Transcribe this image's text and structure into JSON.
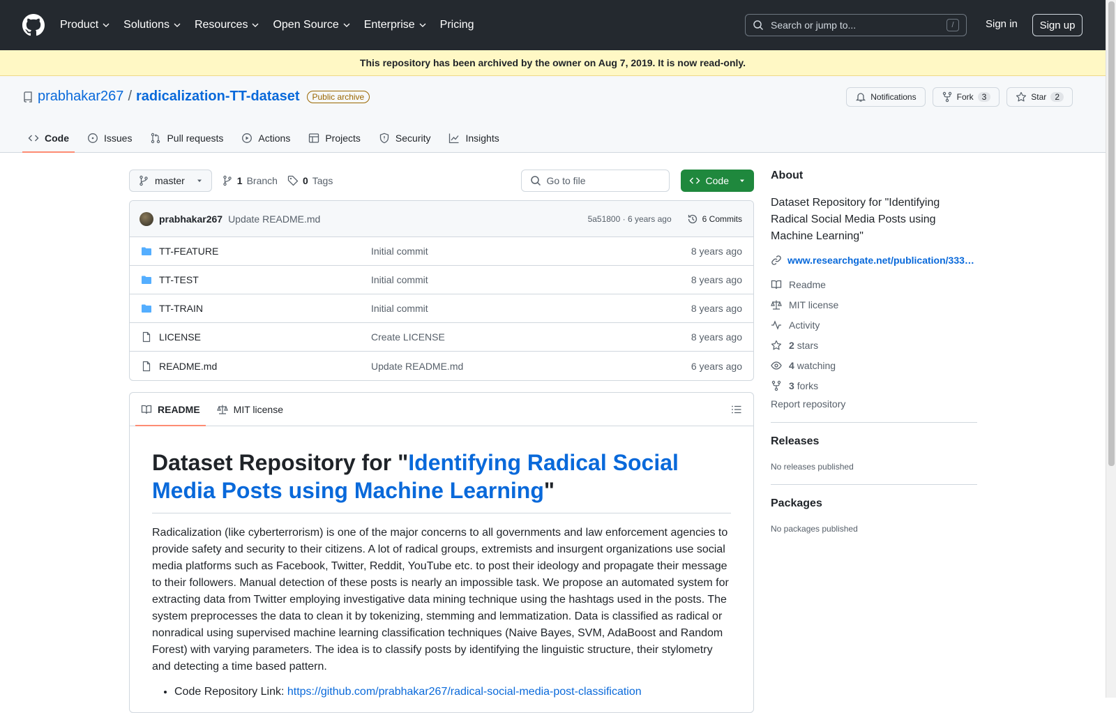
{
  "header": {
    "nav": [
      "Product",
      "Solutions",
      "Resources",
      "Open Source",
      "Enterprise",
      "Pricing"
    ],
    "search_placeholder": "Search or jump to...",
    "search_shortcut": "/",
    "signin": "Sign in",
    "signup": "Sign up"
  },
  "banner": "This repository has been archived by the owner on Aug 7, 2019. It is now read-only.",
  "repo": {
    "owner": "prabhakar267",
    "separator": "/",
    "name": "radicalization-TT-dataset",
    "visibility": "Public archive",
    "notifications": "Notifications",
    "fork_label": "Fork",
    "fork_count": "3",
    "star_label": "Star",
    "star_count": "2",
    "tabs": [
      "Code",
      "Issues",
      "Pull requests",
      "Actions",
      "Projects",
      "Security",
      "Insights"
    ]
  },
  "toolbar": {
    "branch": "master",
    "branch_count": "1",
    "branch_label": "Branch",
    "tag_count": "0",
    "tag_label": "Tags",
    "goto_placeholder": "Go to file",
    "code_button": "Code"
  },
  "commit": {
    "author": "prabhakar267",
    "message": "Update README.md",
    "sha_time": "5a51800 · 6 years ago",
    "commits": "6 Commits"
  },
  "files": [
    {
      "type": "dir",
      "name": "TT-FEATURE",
      "message": "Initial commit",
      "date": "8 years ago"
    },
    {
      "type": "dir",
      "name": "TT-TEST",
      "message": "Initial commit",
      "date": "8 years ago"
    },
    {
      "type": "dir",
      "name": "TT-TRAIN",
      "message": "Initial commit",
      "date": "8 years ago"
    },
    {
      "type": "file",
      "name": "LICENSE",
      "message": "Create LICENSE",
      "date": "8 years ago"
    },
    {
      "type": "file",
      "name": "README.md",
      "message": "Update README.md",
      "date": "6 years ago"
    }
  ],
  "readme": {
    "tab_readme": "README",
    "tab_license": "MIT license",
    "title_prefix": "Dataset Repository for \"",
    "title_link": "Identifying Radical Social Media Posts using Machine Learning",
    "title_suffix": "\"",
    "paragraph": "Radicalization (like cyberterrorism) is one of the major concerns to all governments and law enforcement agencies to provide safety and security to their citizens. A lot of radical groups, extremists and insurgent organizations use social media platforms such as Facebook, Twitter, Reddit, YouTube etc. to post their ideology and propagate their message to their followers. Manual detection of these posts is nearly an impossible task. We propose an automated system for extracting data from Twitter employing investigative data mining technique using the hashtags used in the posts. The system preprocesses the data to clean it by tokenizing, stemming and lemmatization. Data is classified as radical or nonradical using supervised machine learning classification techniques (Naive Bayes, SVM, AdaBoost and Random Forest) with varying parameters. The idea is to classify posts by identifying the linguistic structure, their stylometry and detecting a time based pattern.",
    "list_label": "Code Repository Link: ",
    "list_link": "https://github.com/prabhakar267/radical-social-media-post-classification"
  },
  "about": {
    "heading": "About",
    "description": "Dataset Repository for \"Identifying Radical Social Media Posts using Machine Learning\"",
    "link": "www.researchgate.net/publication/333…",
    "readme": "Readme",
    "license": "MIT license",
    "activity": "Activity",
    "stars_count": "2",
    "stars_label": "stars",
    "watching_count": "4",
    "watching_label": "watching",
    "forks_count": "3",
    "forks_label": "forks",
    "report": "Report repository"
  },
  "releases": {
    "heading": "Releases",
    "empty": "No releases published"
  },
  "packages": {
    "heading": "Packages",
    "empty": "No packages published"
  },
  "colors": {
    "header_bg": "#24292f",
    "banner_bg": "#fff8c5",
    "link": "#0969da",
    "code_button": "#1f883d",
    "tab_underline": "#fd8c73"
  }
}
